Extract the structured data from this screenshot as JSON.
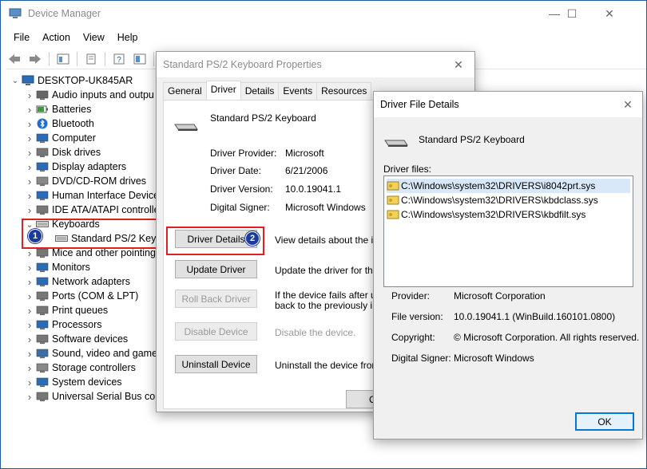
{
  "device_manager": {
    "title": "Device Manager",
    "caption": {
      "minimize": "—",
      "maximize": "☐",
      "close": "✕"
    },
    "menu": [
      "File",
      "Action",
      "View",
      "Help"
    ],
    "root": "DESKTOP-UK845AR",
    "categories": [
      "Audio inputs and outpu",
      "Batteries",
      "Bluetooth",
      "Computer",
      "Disk drives",
      "Display adapters",
      "DVD/CD-ROM drives",
      "Human Interface Device",
      "IDE ATA/ATAPI controlle",
      "Keyboards",
      "Standard PS/2 Keybo",
      "Mice and other pointing",
      "Monitors",
      "Network adapters",
      "Ports (COM & LPT)",
      "Print queues",
      "Processors",
      "Software devices",
      "Sound, video and game",
      "Storage controllers",
      "System devices",
      "Universal Serial Bus cont"
    ],
    "badges": [
      "1",
      "2"
    ]
  },
  "properties": {
    "title": "Standard PS/2 Keyboard Properties",
    "close": "✕",
    "tabs": [
      "General",
      "Driver",
      "Details",
      "Events",
      "Resources"
    ],
    "device_name": "Standard PS/2 Keyboard",
    "fields": {
      "provider_label": "Driver Provider:",
      "provider_value": "Microsoft",
      "date_label": "Driver Date:",
      "date_value": "6/21/2006",
      "version_label": "Driver Version:",
      "version_value": "10.0.19041.1",
      "signer_label": "Digital Signer:",
      "signer_value": "Microsoft Windows"
    },
    "buttons": {
      "details": "Driver Details",
      "details_desc": "View details about the insta",
      "update": "Update Driver",
      "update_desc": "Update the driver for this d",
      "rollback": "Roll Back Driver",
      "rollback_desc1": "If the device fails after upd",
      "rollback_desc2": "back to the previously insta",
      "disable": "Disable Device",
      "disable_desc": "Disable the device.",
      "uninstall": "Uninstall Device",
      "uninstall_desc": "Uninstall the device from th",
      "ok_partial": "C"
    }
  },
  "driver_file_details": {
    "title": "Driver File Details",
    "close": "✕",
    "device_name": "Standard PS/2 Keyboard",
    "files_label": "Driver files:",
    "files": [
      "C:\\Windows\\system32\\DRIVERS\\i8042prt.sys",
      "C:\\Windows\\system32\\DRIVERS\\kbdclass.sys",
      "C:\\Windows\\system32\\DRIVERS\\kbdfilt.sys"
    ],
    "info": {
      "provider_label": "Provider:",
      "provider_value": "Microsoft Corporation",
      "version_label": "File version:",
      "version_value": "10.0.19041.1 (WinBuild.160101.0800)",
      "copyright_label": "Copyright:",
      "copyright_value": "© Microsoft Corporation. All rights reserved.",
      "signer_label": "Digital Signer:",
      "signer_value": "Microsoft Windows"
    },
    "ok": "OK"
  },
  "colors": {
    "highlight_box": "#e02020",
    "badge": "#1a3aa0",
    "selection": "#d8e8f8",
    "ok_border": "#0078d7"
  }
}
